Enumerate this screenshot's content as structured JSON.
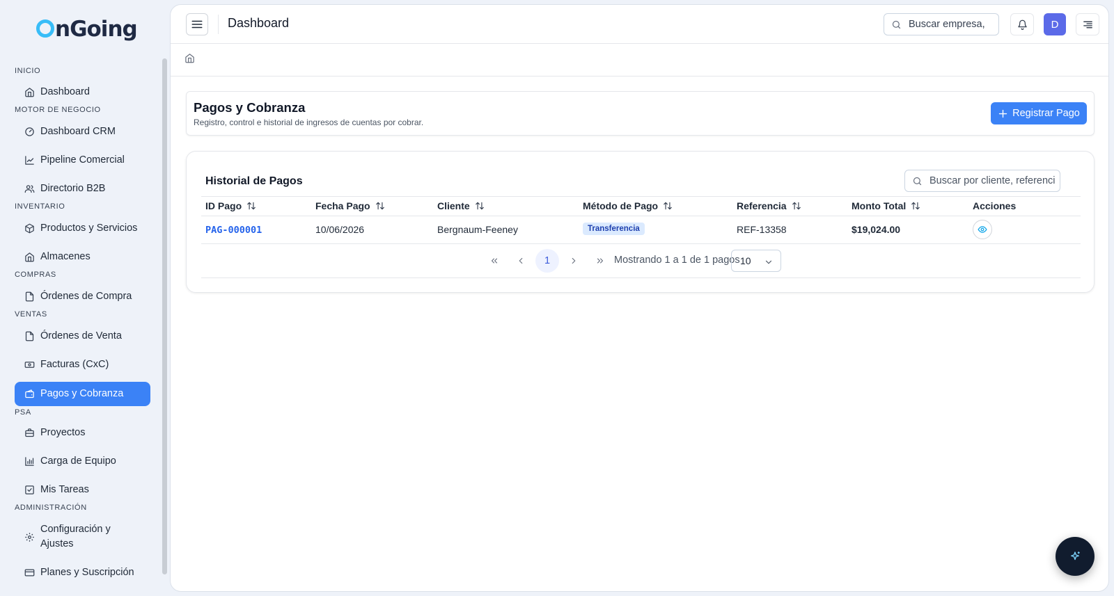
{
  "app": {
    "logo_text": "nGoing",
    "logo_first_letter": "O"
  },
  "sidebar": {
    "sections": {
      "inicio": "INICIO",
      "motor": "MOTOR DE NEGOCIO",
      "inventario": "INVENTARIO",
      "compras": "COMPRAS",
      "ventas": "VENTAS",
      "psa": "PSA",
      "admin": "ADMINISTRACIÓN"
    },
    "items": {
      "dashboard": "Dashboard",
      "dashboard_crm": "Dashboard CRM",
      "pipeline": "Pipeline Comercial",
      "directorio": "Directorio B2B",
      "productos": "Productos y Servicios",
      "almacenes": "Almacenes",
      "ordenes_compra": "Órdenes de Compra",
      "ordenes_venta": "Órdenes de Venta",
      "facturas": "Facturas (CxC)",
      "pagos": "Pagos y Cobranza",
      "proyectos": "Proyectos",
      "carga": "Carga de Equipo",
      "tareas": "Mis Tareas",
      "config": "Configuración y Ajustes",
      "planes": "Planes y Suscripción"
    },
    "active_item": "pagos"
  },
  "topbar": {
    "title": "Dashboard",
    "search_placeholder": "Buscar empresa,",
    "avatar_initial": "D"
  },
  "page": {
    "title": "Pagos y Cobranza",
    "subtitle": "Registro, control e historial de ingresos de cuentas por cobrar.",
    "primary_button": "Registrar Pago"
  },
  "table": {
    "title": "Historial de Pagos",
    "search_placeholder": "Buscar por cliente, referencia",
    "columns": {
      "id": "ID Pago",
      "fecha": "Fecha Pago",
      "cliente": "Cliente",
      "metodo": "Método de Pago",
      "referencia": "Referencia",
      "monto": "Monto Total",
      "acciones": "Acciones"
    },
    "rows": [
      {
        "id": "PAG-000001",
        "fecha": "10/06/2026",
        "cliente": "Bergnaum-Feeney",
        "metodo": "Transferencia",
        "referencia": "REF-13358",
        "monto": "$19,024.00"
      }
    ],
    "pagination": {
      "current_page": "1",
      "info": "Mostrando 1 a 1 de 1 pagos",
      "page_size": "10"
    }
  },
  "colors": {
    "primary": "#3b82f6",
    "link": "#2563eb",
    "badge_bg": "#dbeafe",
    "avatar": "#5b6ae8",
    "fab": "#111c2e"
  }
}
